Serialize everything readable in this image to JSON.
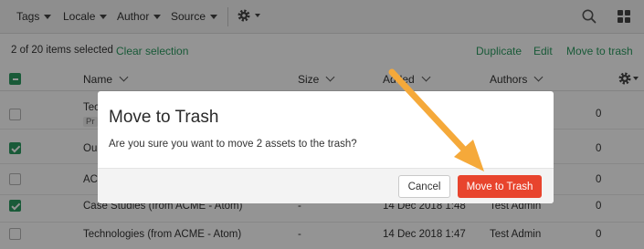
{
  "toolbar": {
    "filters": [
      "Tags",
      "Locale",
      "Author",
      "Source"
    ]
  },
  "selection": {
    "count_text": "2 of 20 items selected",
    "clear_label": "Clear selection",
    "actions": [
      "Duplicate",
      "Edit",
      "Move to trash"
    ]
  },
  "table": {
    "columns": [
      "Name",
      "Size",
      "Added",
      "Authors"
    ],
    "rows": [
      {
        "name": "Tec",
        "tag": "Pr",
        "size": "",
        "added": "",
        "author": "",
        "count": "0",
        "checked": false
      },
      {
        "name": "Ou",
        "tag": "",
        "size": "",
        "added": "",
        "author": "",
        "count": "0",
        "checked": true
      },
      {
        "name": "AC",
        "tag": "",
        "size": "",
        "added": "",
        "author": "",
        "count": "0",
        "checked": false
      },
      {
        "name": "Case Studies (from ACME - Atom)",
        "tag": "",
        "size": "-",
        "added": "14 Dec 2018 1:48",
        "author": "Test Admin",
        "count": "0",
        "checked": true
      },
      {
        "name": "Technologies (from ACME - Atom)",
        "tag": "",
        "size": "-",
        "added": "14 Dec 2018 1:47",
        "author": "Test Admin",
        "count": "0",
        "checked": false
      }
    ]
  },
  "dialog": {
    "title": "Move to Trash",
    "message": "Are you sure you want to move 2 assets to the trash?",
    "cancel_label": "Cancel",
    "confirm_label": "Move to Trash"
  },
  "colors": {
    "accent_green": "#2c9b61",
    "danger_red": "#e8442d",
    "annotation_arrow": "#f5a93a"
  }
}
